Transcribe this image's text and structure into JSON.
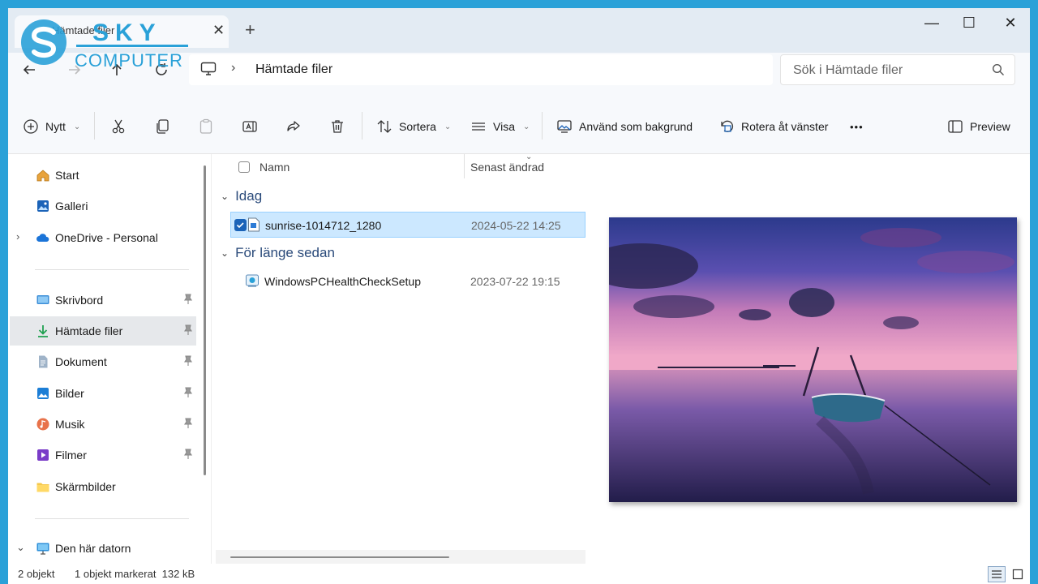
{
  "tab": {
    "title": "Hämtade filer",
    "close": "✕",
    "new": "+"
  },
  "window_controls": {
    "minimize": "—",
    "maximize": "☐",
    "close": "✕"
  },
  "address": {
    "crumb": "Hämtade filer"
  },
  "search": {
    "placeholder": "Sök i Hämtade filer"
  },
  "toolbar": {
    "new_label": "Nytt",
    "sort_label": "Sortera",
    "view_label": "Visa",
    "set_bg_label": "Använd som bakgrund",
    "rotate_label": "Rotera åt vänster",
    "more_label": "•••",
    "preview_label": "Preview"
  },
  "sidebar": {
    "items": [
      {
        "label": "Start",
        "icon": "home-icon"
      },
      {
        "label": "Galleri",
        "icon": "gallery-icon"
      },
      {
        "label": "OneDrive - Personal",
        "icon": "cloud-icon"
      },
      {
        "label": "Skrivbord",
        "icon": "desktop-icon"
      },
      {
        "label": "Hämtade filer",
        "icon": "download-icon"
      },
      {
        "label": "Dokument",
        "icon": "document-icon"
      },
      {
        "label": "Bilder",
        "icon": "pictures-icon"
      },
      {
        "label": "Musik",
        "icon": "music-icon"
      },
      {
        "label": "Filmer",
        "icon": "video-icon"
      },
      {
        "label": "Skärmbilder",
        "icon": "folder-icon"
      },
      {
        "label": "Den här datorn",
        "icon": "computer-icon"
      }
    ]
  },
  "columns": {
    "name": "Namn",
    "modified": "Senast ändrad"
  },
  "groups": [
    {
      "title": "Idag",
      "files": [
        {
          "name": "sunrise-1014712_1280",
          "modified": "2024-05-22 14:25",
          "selected": true
        }
      ]
    },
    {
      "title": "För länge sedan",
      "files": [
        {
          "name": "WindowsPCHealthCheckSetup",
          "modified": "2023-07-22 19:15",
          "selected": false
        }
      ]
    }
  ],
  "status": {
    "count": "2 objekt",
    "selection": "1 objekt markerat  132 kB"
  },
  "watermark": {
    "line1": "SKY",
    "line2": "COMPUTER"
  },
  "colors": {
    "accent": "#1b63b8",
    "selected_row": "#cce8ff",
    "frame": "#2aa1d8",
    "group_header": "#2a4a7a"
  }
}
